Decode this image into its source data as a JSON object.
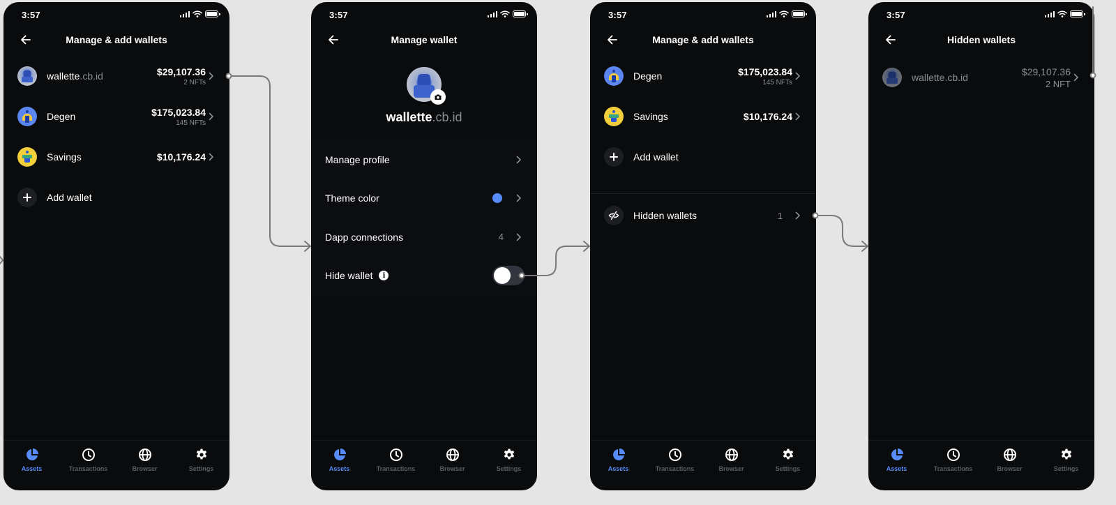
{
  "colors": {
    "accent": "#578bfa",
    "background": "#e5e5e5",
    "screen": "#0a0b0d",
    "muted_text": "#8a8d94",
    "connector": "#7a7a7a"
  },
  "status_bar": {
    "time": "3:57",
    "icons": [
      "signal-icon",
      "wifi-icon",
      "battery-icon"
    ]
  },
  "tabbar": {
    "tabs": [
      {
        "label": "Assets",
        "icon": "pie-chart-icon",
        "active": true
      },
      {
        "label": "Transactions",
        "icon": "clock-icon",
        "active": false
      },
      {
        "label": "Browser",
        "icon": "globe-icon",
        "active": false
      },
      {
        "label": "Settings",
        "icon": "gear-icon",
        "active": false
      }
    ]
  },
  "screens": [
    {
      "title": "Manage & add wallets",
      "wallets": [
        {
          "name_main": "wallette",
          "name_suffix": ".cb.id",
          "amount": "$29,107.36",
          "sub": "2 NFTs",
          "avatar": "nft-avatar"
        },
        {
          "name_main": "Degen",
          "name_suffix": "",
          "amount": "$175,023.84",
          "sub": "145 NFTs",
          "avatar": "degen-avatar"
        },
        {
          "name_main": "Savings",
          "name_suffix": "",
          "amount": "$10,176.24",
          "sub": "",
          "avatar": "savings-avatar"
        }
      ],
      "add_wallet_label": "Add wallet"
    },
    {
      "title": "Manage wallet",
      "profile": {
        "name_main": "wallette",
        "name_suffix": ".cb.id"
      },
      "items": [
        {
          "label": "Manage profile"
        },
        {
          "label": "Theme color",
          "theme_color": "#578bfa"
        },
        {
          "label": "Dapp connections",
          "count": "4"
        },
        {
          "label": "Hide wallet",
          "toggle_on": false
        }
      ]
    },
    {
      "title": "Manage & add wallets",
      "wallets": [
        {
          "name_main": "Degen",
          "name_suffix": "",
          "amount": "$175,023.84",
          "sub": "145 NFTs",
          "avatar": "degen-avatar"
        },
        {
          "name_main": "Savings",
          "name_suffix": "",
          "amount": "$10,176.24",
          "sub": "",
          "avatar": "savings-avatar"
        }
      ],
      "add_wallet_label": "Add wallet",
      "hidden_wallets_label": "Hidden wallets",
      "hidden_wallets_count": "1"
    },
    {
      "title": "Hidden wallets",
      "wallets": [
        {
          "name": "wallette.cb.id",
          "amount": "$29,107.36",
          "sub": "2 NFT",
          "avatar": "nft-avatar"
        }
      ]
    }
  ]
}
